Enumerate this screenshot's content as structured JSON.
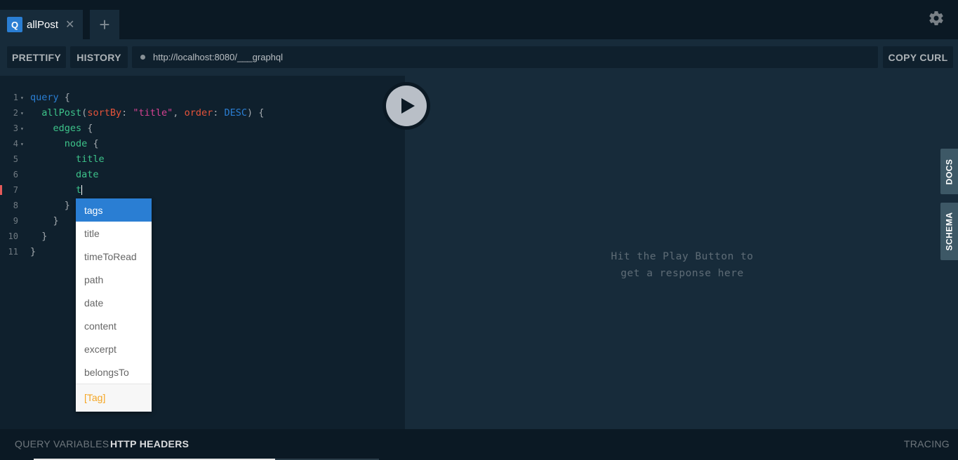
{
  "tab": {
    "badge": "Q",
    "title": "allPost",
    "close": "✕"
  },
  "new_tab": "+",
  "toolbar": {
    "prettify": "PRETTIFY",
    "history": "HISTORY",
    "url": "http://localhost:8080/___graphql",
    "copy_curl": "COPY CURL"
  },
  "editor": {
    "lines": [
      {
        "n": "1",
        "fold": "▾"
      },
      {
        "n": "2",
        "fold": "▾"
      },
      {
        "n": "3",
        "fold": "▾"
      },
      {
        "n": "4",
        "fold": "▾"
      },
      {
        "n": "5",
        "fold": ""
      },
      {
        "n": "6",
        "fold": ""
      },
      {
        "n": "7",
        "fold": ""
      },
      {
        "n": "8",
        "fold": ""
      },
      {
        "n": "9",
        "fold": ""
      },
      {
        "n": "10",
        "fold": ""
      },
      {
        "n": "11",
        "fold": ""
      }
    ],
    "tokens": {
      "query_kw": "query",
      "brace_open": "{",
      "brace_close": "}",
      "allpost": "allPost",
      "paren_open": "(",
      "paren_close": ")",
      "sortby": "sortBy",
      "colon": ":",
      "title_str": "\"title\"",
      "comma": ",",
      "order": "order",
      "desc": "DESC",
      "edges": "edges",
      "node": "node",
      "title": "title",
      "date": "date",
      "typed": "t"
    }
  },
  "autocomplete": {
    "items": [
      "tags",
      "title",
      "timeToRead",
      "path",
      "date",
      "content",
      "excerpt",
      "belongsTo"
    ],
    "selected_index": 0,
    "type_hint": "[Tag]"
  },
  "result": {
    "placeholder_line1": "Hit the Play Button to",
    "placeholder_line2": "get a response here"
  },
  "side_tabs": {
    "docs": "DOCS",
    "schema": "SCHEMA"
  },
  "bottom": {
    "query_variables": "QUERY VARIABLES",
    "http_headers": "HTTP HEADERS",
    "tracing": "TRACING"
  },
  "colors": {
    "accent": "#2a7ed3",
    "field": "#3dc38a",
    "argument": "#e6533a",
    "string": "#d64292",
    "type_hint": "#f5a623"
  }
}
